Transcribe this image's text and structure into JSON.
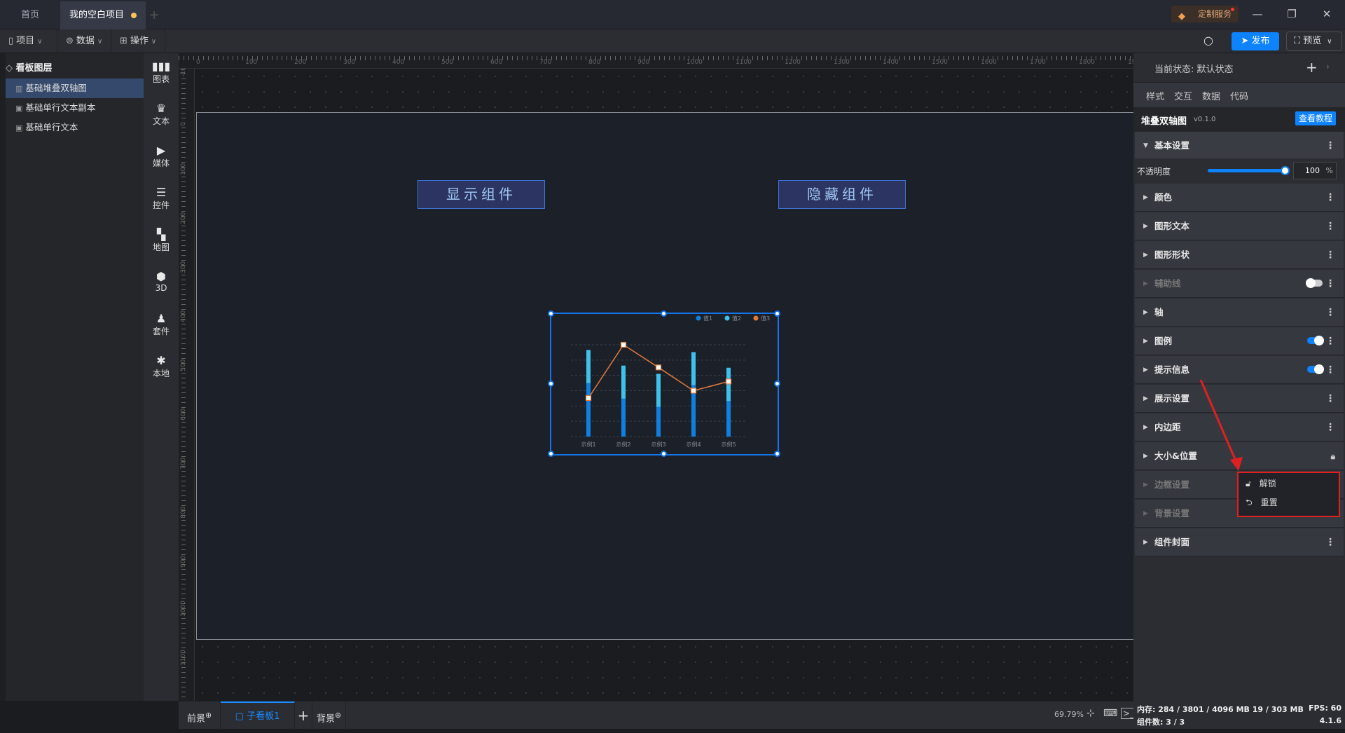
{
  "tabs": {
    "home": "首页",
    "project": "我的空白项目",
    "add": "+"
  },
  "service": {
    "label": "定制服务"
  },
  "window": {
    "minimize": "—",
    "restore": "❐",
    "close": "✕"
  },
  "toolbar": {
    "project": "项目",
    "data": "数据",
    "operate": "操作",
    "publish": "发布",
    "preview": "预览"
  },
  "layers": {
    "title": "看板图层",
    "items": [
      "基础堆叠双轴图",
      "基础单行文本副本",
      "基础单行文本"
    ]
  },
  "tools": [
    "图表",
    "文本",
    "媒体",
    "控件",
    "地图",
    "3D",
    "套件",
    "本地"
  ],
  "ruler": {
    "top": [
      "0",
      "100",
      "200",
      "300",
      "400",
      "500",
      "600",
      "700",
      "800",
      "900",
      "1000",
      "1100",
      "1200",
      "1300",
      "1400",
      "1500",
      "1600",
      "1700",
      "1800",
      "1900"
    ],
    "left": [
      "-100",
      "0",
      "100",
      "200",
      "300",
      "400",
      "500",
      "600",
      "700",
      "800",
      "900",
      "1000",
      "1100"
    ]
  },
  "canvas": {
    "show_button": "显示组件",
    "hide_button": "隐藏组件"
  },
  "chart_data": {
    "type": "bar",
    "categories": [
      "示例1",
      "示例2",
      "示例3",
      "示例4",
      "示例5"
    ],
    "series": [
      {
        "name": "值1",
        "kind": "stacked-bar",
        "color": "#0f7fe0",
        "values": [
          17.5,
          12.4,
          9.7,
          16.8,
          11.6
        ]
      },
      {
        "name": "值2",
        "kind": "stacked-bar",
        "color": "#3fc1ec",
        "values": [
          10.8,
          10.8,
          10.8,
          10.8,
          10.9
        ]
      },
      {
        "name": "值3",
        "kind": "line",
        "color": "#e07b3c",
        "values": [
          12.6,
          30,
          22.6,
          15,
          18
        ]
      }
    ],
    "ylim": [
      0,
      30
    ],
    "grid": true,
    "legend": "top-right"
  },
  "panel": {
    "state": "当前状态:  默认状态",
    "add": "+",
    "arrow": "›",
    "tabs": [
      "样式",
      "交互",
      "数据",
      "代码"
    ],
    "component": "堆叠双轴图",
    "version": "v0.1.0",
    "tutorial": "查看教程",
    "basic": "基本设置",
    "opacity_label": "不透明度",
    "opacity_value": "100",
    "opacity_unit": "%",
    "opacity": 1.0,
    "sections": [
      {
        "label": "颜色"
      },
      {
        "label": "图形文本"
      },
      {
        "label": "图形形状"
      },
      {
        "label": "辅助线",
        "disabled": true,
        "toggle": false
      },
      {
        "label": "轴"
      },
      {
        "label": "图例",
        "toggle": true
      },
      {
        "label": "提示信息",
        "toggle": true
      },
      {
        "label": "展示设置"
      },
      {
        "label": "内边距"
      },
      {
        "label": "大小&位置",
        "locked": true
      },
      {
        "label": "边框设置",
        "disabled": true
      },
      {
        "label": "背景设置",
        "disabled": true
      },
      {
        "label": "组件封面"
      }
    ],
    "popup": {
      "unlock": "解锁",
      "reset": "重置"
    }
  },
  "bottom": {
    "foreground": "前景",
    "board": "子看板1",
    "add": "+",
    "background": "背景",
    "zoom": "69.79%"
  },
  "status": {
    "memory": "内存:  284 / 3801 / 4096 MB  19 / 303 MB",
    "fps": "FPS:  60",
    "components": "组件数: 3 / 3",
    "version": "4.1.6"
  },
  "colors": {
    "accent": "#0d83ff",
    "annotation": "#e02020"
  }
}
